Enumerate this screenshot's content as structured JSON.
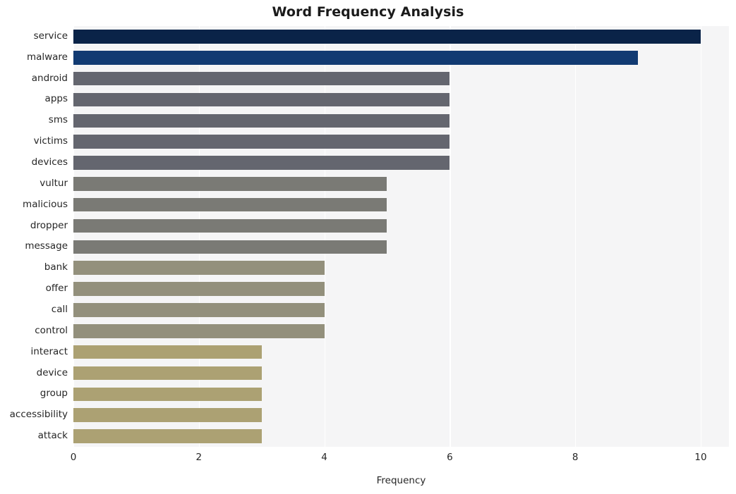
{
  "chart_data": {
    "type": "bar",
    "orientation": "horizontal",
    "title": "Word Frequency Analysis",
    "xlabel": "Frequency",
    "ylabel": "",
    "xlim": [
      0,
      10.45
    ],
    "xticks": [
      0,
      2,
      4,
      6,
      8,
      10
    ],
    "xticklabels": [
      "0",
      "2",
      "4",
      "6",
      "8",
      "10"
    ],
    "grid": true,
    "grid_axis": "x",
    "legend": false,
    "categories": [
      "service",
      "malware",
      "android",
      "apps",
      "sms",
      "victims",
      "devices",
      "vultur",
      "malicious",
      "dropper",
      "message",
      "bank",
      "offer",
      "call",
      "control",
      "interact",
      "device",
      "group",
      "accessibility",
      "attack"
    ],
    "values": [
      10,
      9,
      6,
      6,
      6,
      6,
      6,
      5,
      5,
      5,
      5,
      4,
      4,
      4,
      4,
      3,
      3,
      3,
      3,
      3
    ],
    "bar_colors": [
      "#0a2348",
      "#113a72",
      "#64666f",
      "#64666f",
      "#64666f",
      "#64666f",
      "#64666f",
      "#7a7a75",
      "#7a7a75",
      "#7a7a75",
      "#7a7a75",
      "#93907c",
      "#93907c",
      "#93907c",
      "#93907c",
      "#aca173",
      "#aca173",
      "#aca173",
      "#aca173",
      "#aca173"
    ],
    "plot_background": "#f5f5f6",
    "gridline_color": "#ffffff",
    "figure_background": "#ffffff",
    "text_color": "#262626"
  }
}
